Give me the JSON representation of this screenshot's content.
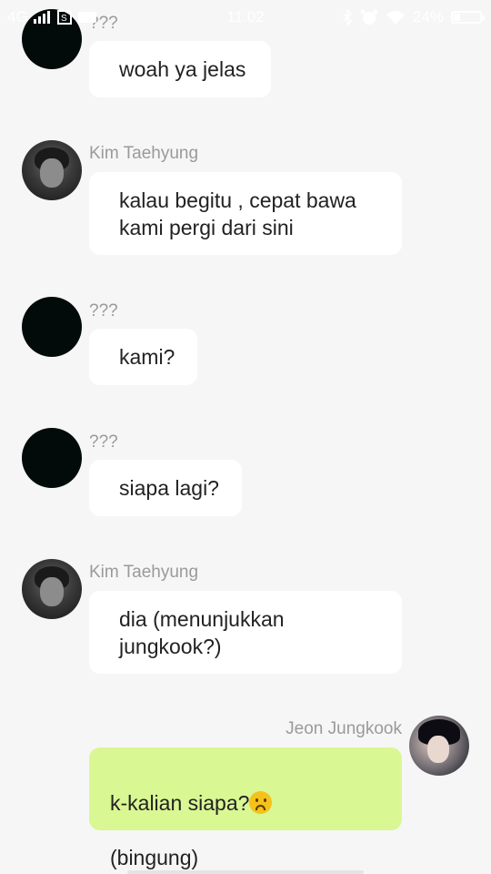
{
  "status_bar": {
    "left_text": "4G",
    "time": "11.02",
    "battery": "24%",
    "battery_level": 0.24
  },
  "messages": [
    {
      "sender": "???",
      "text": "woah ya jelas",
      "avatar": "unknown"
    },
    {
      "sender": "Kim Taehyung",
      "text": "kalau begitu , cepat bawa kami pergi dari sini",
      "avatar": "taehyung"
    },
    {
      "sender": "???",
      "text": "kami?",
      "avatar": "unknown"
    },
    {
      "sender": "???",
      "text": "siapa lagi?",
      "avatar": "unknown"
    },
    {
      "sender": "Kim Taehyung",
      "text": "dia (menunjukkan jungkook?)",
      "avatar": "taehyung"
    },
    {
      "sender": "Jeon Jungkook",
      "text": "k-kalian siapa?",
      "text2": "(bingung)",
      "emoji": "frowning-face",
      "avatar": "jungkook",
      "mine": true
    }
  ]
}
